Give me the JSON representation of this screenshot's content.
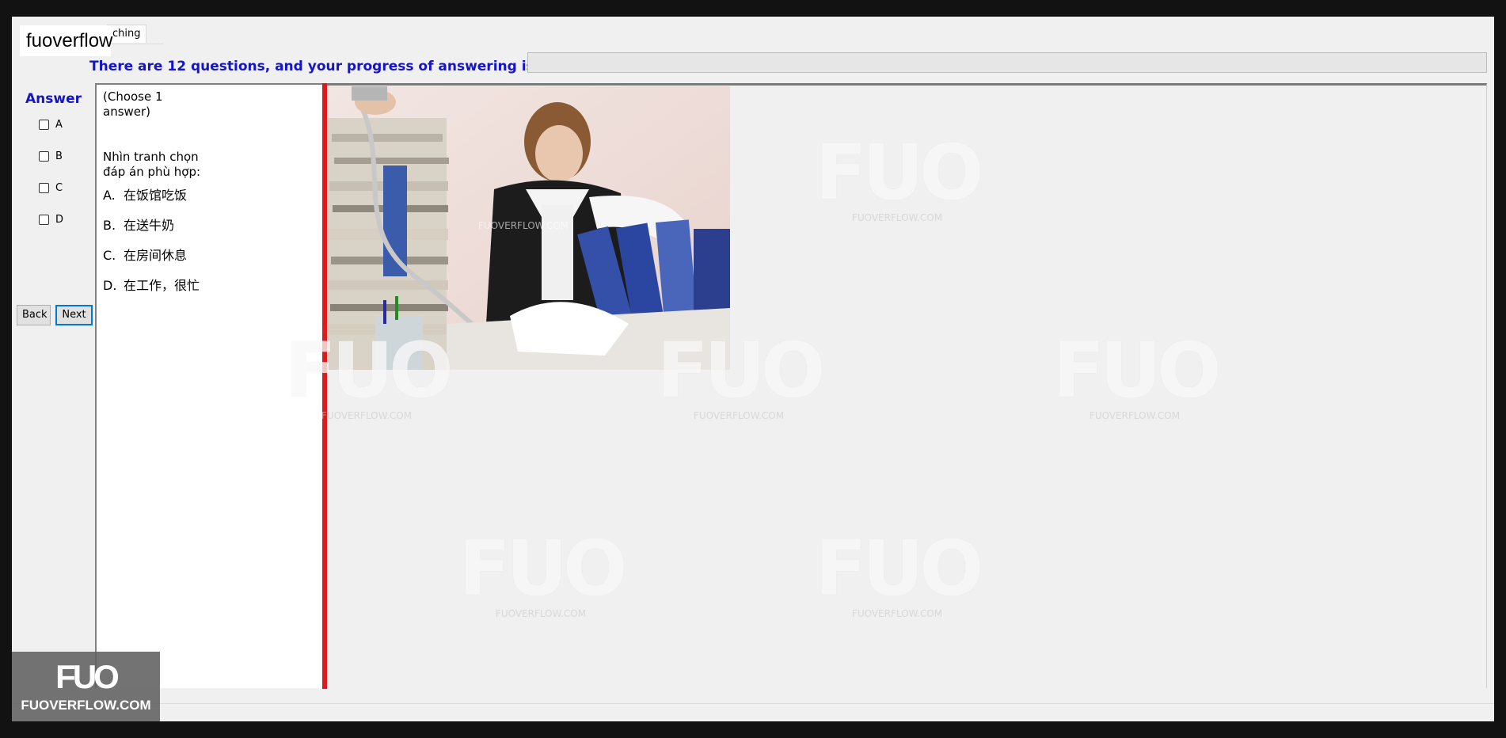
{
  "overlay_tag": "fuoverflow",
  "tab": {
    "label": "ching"
  },
  "header": {
    "progress_text": "There are 12 questions, and your progress of answering is",
    "progress_value": 0
  },
  "answer": {
    "title": "Answer",
    "options": [
      "A",
      "B",
      "C",
      "D"
    ]
  },
  "nav": {
    "back_label": "Back",
    "next_label": "Next"
  },
  "question": {
    "instruction_line1": "(Choose 1",
    "instruction_line2": "answer)",
    "prompt_line1": "Nhìn tranh chọn",
    "prompt_line2": "đáp án phù hợp:",
    "options": [
      {
        "letter": "A.",
        "text": "在饭馆吃饭"
      },
      {
        "letter": "B.",
        "text": "在送牛奶"
      },
      {
        "letter": "C.",
        "text": "在房间休息"
      },
      {
        "letter": "D.",
        "text": "在工作，很忙"
      }
    ]
  },
  "watermark": {
    "logo": "FUO",
    "site": "FUOVERFLOW.COM"
  },
  "brand_badge": {
    "logo": "FUO",
    "site": "FUOVERFLOW.COM"
  },
  "colors": {
    "accent_blue": "#1414c8",
    "splitter_red": "#e0191c",
    "window_bg": "#f0f0f0"
  },
  "photo": {
    "icon": "office-worker-photo"
  }
}
